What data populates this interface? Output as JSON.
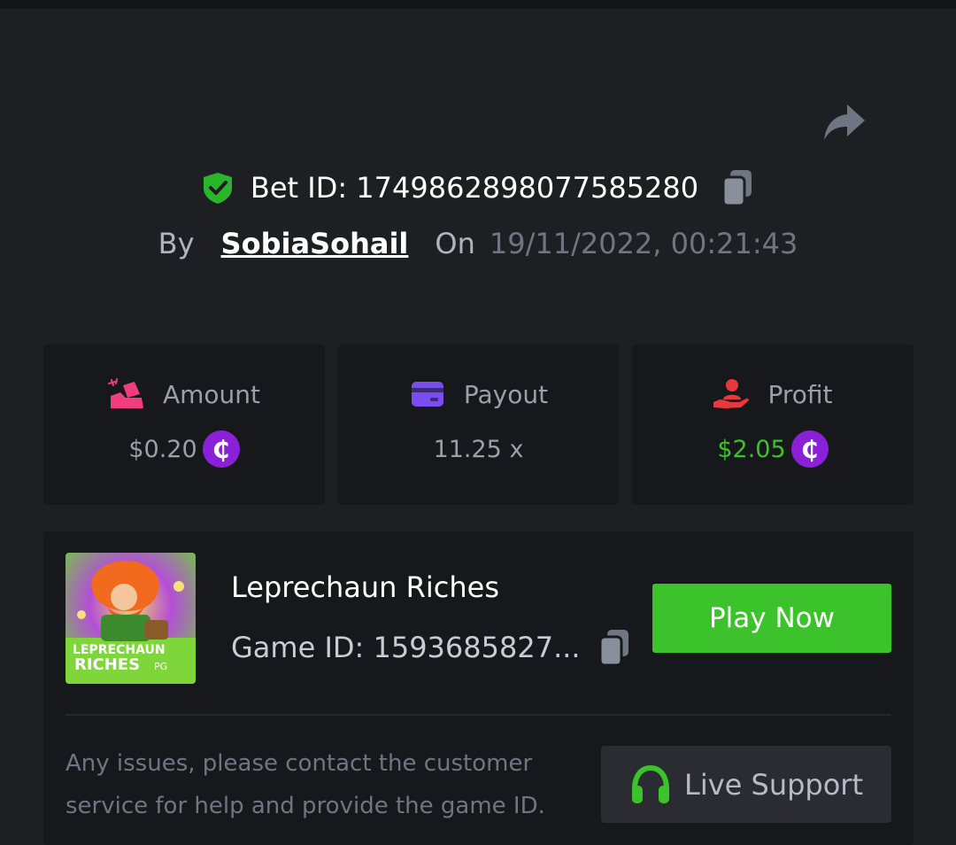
{
  "bet": {
    "id_text": "Bet ID: 1749862898077585280",
    "by_label": "By",
    "username": "SobiaSohail",
    "on_label": "On",
    "datetime": "19/11/2022, 00:21:43"
  },
  "stats": [
    {
      "label": "Amount",
      "value": "$0.20",
      "icon": "amount-icon",
      "coin": "₵",
      "value_color": "#99a0ac"
    },
    {
      "label": "Payout",
      "value": "11.25 x",
      "icon": "card-icon",
      "value_color": "#99a0ac"
    },
    {
      "label": "Profit",
      "value": "$2.05",
      "icon": "hand-user-icon",
      "coin": "₵",
      "value_color": "#3cc22a"
    }
  ],
  "game": {
    "title": "Leprechaun Riches",
    "id_text": "Game ID: 1593685827...",
    "thumbnail_text_1": "LEPRECHAUN",
    "thumbnail_text_2": "RICHES",
    "thumbnail_brand": "PG",
    "play_label": "Play Now"
  },
  "support": {
    "help_text": "Any issues, please contact the customer service for help and provide the game ID.",
    "button_label": "Live Support"
  },
  "colors": {
    "background": "#1e1f23",
    "card": "#17181b",
    "accent_green": "#3cc22a",
    "coin_purple": "#8a21d8",
    "amount_pink": "#ef3d7d",
    "payout_purple": "#7b4cf0",
    "profit_red": "#e8383d"
  }
}
